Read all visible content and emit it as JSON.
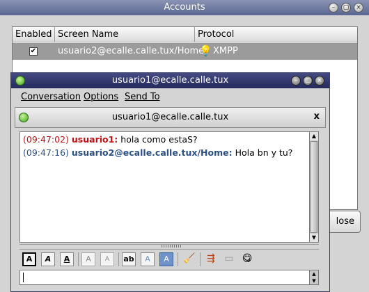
{
  "accounts_window": {
    "title": "Accounts",
    "title_buttons": [
      "minimize-icon",
      "maximize-icon",
      "close-icon"
    ],
    "table": {
      "columns": [
        "Enabled",
        "Screen Name",
        "Protocol"
      ],
      "rows": [
        {
          "enabled": true,
          "screen_name": "usuario2@ecalle.calle.tux/Home",
          "protocol": "XMPP",
          "protocol_icon": "lightbulb-icon"
        }
      ]
    },
    "close_button_label": "lose"
  },
  "chat_window": {
    "title": "usuario1@ecalle.calle.tux",
    "status_icon": "online-status-icon",
    "title_buttons": [
      "minimize-icon",
      "maximize-icon",
      "close-icon"
    ],
    "menu": [
      "Conversation",
      "Options",
      "Send To"
    ],
    "tab": {
      "label": "usuario1@ecalle.calle.tux",
      "close": "x"
    },
    "messages": [
      {
        "time": "(09:47:02)",
        "sender": "usuario1:",
        "text": "hola como estaS?",
        "color": "#c01010"
      },
      {
        "time": "(09:47:16)",
        "sender": "usuario2@ecalle.calle.tux/Home:",
        "text": "Hola bn y tu?",
        "color": "#2c4f86"
      }
    ],
    "toolbar": {
      "buttons": [
        {
          "name": "bold-button",
          "label": "A"
        },
        {
          "name": "italic-button",
          "label": "A"
        },
        {
          "name": "underline-button",
          "label": "A"
        },
        {
          "name": "larger-font-button",
          "label": "A"
        },
        {
          "name": "smaller-font-button",
          "label": "A"
        },
        {
          "name": "font-face-button",
          "label": "ab"
        },
        {
          "name": "foreground-color-button",
          "label": "A"
        },
        {
          "name": "background-color-button",
          "label": "A"
        }
      ],
      "icons": [
        "clear-formatting-icon",
        "insert-link-icon",
        "insert-image-icon",
        "smiley-icon"
      ]
    },
    "input": {
      "value": ""
    }
  },
  "colors": {
    "accounts_titlebar": "#6f7aa3",
    "chat_titlebar": "#2f3470",
    "selected_row": "#9b9b9b",
    "own_nick": "#c01010",
    "buddy_nick": "#2c4f86"
  }
}
